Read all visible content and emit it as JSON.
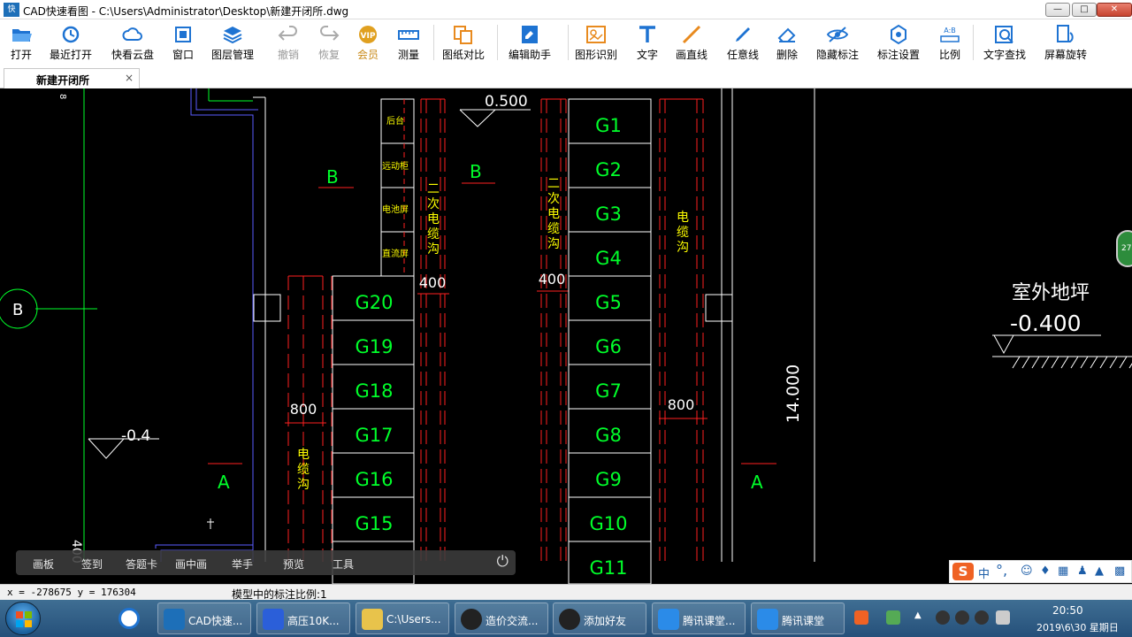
{
  "window": {
    "title": "CAD快速看图 - C:\\Users\\Administrator\\Desktop\\新建开闭所.dwg",
    "app_icon_text": "快"
  },
  "window_buttons": {
    "minimize": "—",
    "maximize": "□",
    "close": "✕"
  },
  "toolbar": [
    {
      "id": "open",
      "label": "打开",
      "icon": "folder-icon",
      "color": "#1e73d2"
    },
    {
      "id": "recent",
      "label": "最近打开",
      "icon": "clock-icon",
      "color": "#1e73d2"
    },
    {
      "id": "cloud",
      "label": "快看云盘",
      "icon": "cloud-icon",
      "color": "#1e73d2"
    },
    {
      "id": "window",
      "label": "窗口",
      "icon": "window-icon",
      "color": "#1e73d2"
    },
    {
      "id": "layers",
      "label": "图层管理",
      "icon": "layers-icon",
      "color": "#1e73d2"
    },
    {
      "id": "undo",
      "label": "撤销",
      "icon": "undo-icon",
      "color": "#aaa"
    },
    {
      "id": "redo",
      "label": "恢复",
      "icon": "redo-icon",
      "color": "#aaa"
    },
    {
      "id": "vip",
      "label": "会员",
      "icon": "vip-icon",
      "color": "#e0a020"
    },
    {
      "id": "measure",
      "label": "测量",
      "icon": "ruler-icon",
      "color": "#1e73d2"
    },
    {
      "id": "compare",
      "label": "图纸对比",
      "icon": "compare-icon",
      "color": "#e88a1e"
    },
    {
      "id": "assistant",
      "label": "编辑助手",
      "icon": "edit-assistant-icon",
      "color": "#1e73d2"
    },
    {
      "id": "recognize",
      "label": "图形识别",
      "icon": "shape-recognize-icon",
      "color": "#e88a1e"
    },
    {
      "id": "text",
      "label": "文字",
      "icon": "text-icon",
      "color": "#1e73d2"
    },
    {
      "id": "line",
      "label": "画直线",
      "icon": "line-icon",
      "color": "#e88a1e"
    },
    {
      "id": "freeline",
      "label": "任意线",
      "icon": "pen-icon",
      "color": "#1e73d2"
    },
    {
      "id": "erase",
      "label": "删除",
      "icon": "eraser-icon",
      "color": "#1e73d2"
    },
    {
      "id": "hide",
      "label": "隐藏标注",
      "icon": "hide-icon",
      "color": "#1e73d2"
    },
    {
      "id": "dimset",
      "label": "标注设置",
      "icon": "dim-settings-icon",
      "color": "#1e73d2"
    },
    {
      "id": "scale",
      "label": "比例",
      "icon": "scale-icon",
      "color": "#1e73d2"
    },
    {
      "id": "find",
      "label": "文字查找",
      "icon": "find-text-icon",
      "color": "#1e73d2"
    },
    {
      "id": "rotate",
      "label": "屏幕旋转",
      "icon": "rotate-screen-icon",
      "color": "#1e73d2"
    }
  ],
  "tab": {
    "label": "新建开闭所",
    "close": "×"
  },
  "drawing": {
    "elevation_top": "0.500",
    "elevation_left": "-0.4",
    "ground_label": "室外地坪",
    "ground_value": "-0.400",
    "section_B": "B",
    "section_A": "A",
    "dim_400": "400",
    "dim_800": "800",
    "dim_height": "14.000",
    "cable_trench": "电缆沟",
    "secondary_cable_trench": "二次电缆沟",
    "small_cabinets": [
      "后台",
      "远动柜",
      "电池屏",
      "直流屏"
    ],
    "left_cabinets": [
      "G20",
      "G19",
      "G18",
      "G17",
      "G16",
      "G15"
    ],
    "right_cabinets": [
      "G1",
      "G2",
      "G3",
      "G4",
      "G5",
      "G6",
      "G7",
      "G8",
      "G9",
      "G10",
      "G11"
    ],
    "side_badge": "27"
  },
  "live_toolbar": [
    "画板",
    "签到",
    "答题卡",
    "画中画",
    "举手",
    "预览",
    "工具"
  ],
  "ime": {
    "logo": "S",
    "lang": "中"
  },
  "status": {
    "coords": "x = -278675  y = 176304",
    "scale_text": "模型中的标注比例:1"
  },
  "taskbar": {
    "items": [
      {
        "label": "CAD快速...",
        "icon": "cad-icon",
        "color": "#1d6fb8"
      },
      {
        "label": "高压10K...",
        "icon": "document-icon",
        "color": "#2b5fd9"
      },
      {
        "label": "C:\\Users...",
        "icon": "explorer-folder-icon",
        "color": "#e8c34b"
      },
      {
        "label": "造价交流...",
        "icon": "qq-icon",
        "color": "#222"
      },
      {
        "label": "添加好友",
        "icon": "qq-icon",
        "color": "#222"
      },
      {
        "label": "腾讯课堂...",
        "icon": "tencent-classroom-icon",
        "color": "#2b8be8"
      },
      {
        "label": "腾讯课堂",
        "icon": "tencent-classroom-icon",
        "color": "#2b8be8"
      }
    ],
    "time": "20:50",
    "date": "2019\\6\\30 星期日"
  }
}
